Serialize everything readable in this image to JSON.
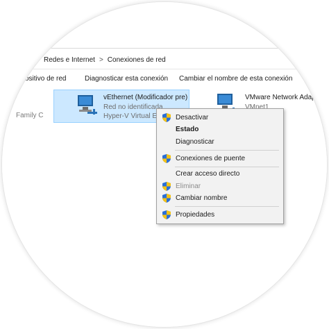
{
  "breadcrumb": {
    "part1": "Redes e Internet",
    "separator": ">",
    "part2": "Conexiones de red"
  },
  "commands": {
    "cmd1": "ositivo de red",
    "cmd2": "Diagnosticar esta conexión",
    "cmd3": "Cambiar el nombre de esta conexión"
  },
  "left_partial": "Family C",
  "adapters": [
    {
      "name": "vEthernet (Modificador pre)",
      "status": "Red no identificada",
      "device": "Hyper-V Virtual Et"
    },
    {
      "name": "VMware Network Adap",
      "status": "VMnet1"
    }
  ],
  "context_menu": {
    "items": [
      {
        "label": "Desactivar",
        "icon": "uac-shield-icon"
      },
      {
        "label": "Estado",
        "bold": true
      },
      {
        "label": "Diagnosticar"
      },
      {
        "label": "Conexiones de puente",
        "icon": "uac-shield-icon"
      },
      {
        "label": "Crear acceso directo"
      },
      {
        "label": "Eliminar",
        "icon": "uac-shield-icon",
        "disabled": true
      },
      {
        "label": "Cambiar nombre",
        "icon": "uac-shield-icon"
      },
      {
        "label": "Propiedades",
        "icon": "uac-shield-icon"
      }
    ]
  },
  "colors": {
    "selection_bg": "#cce8ff",
    "selection_border": "#99d1ff",
    "menu_bg": "#f2f2f2",
    "shield_blue": "#2b6fd6",
    "shield_yellow": "#f4c316"
  }
}
